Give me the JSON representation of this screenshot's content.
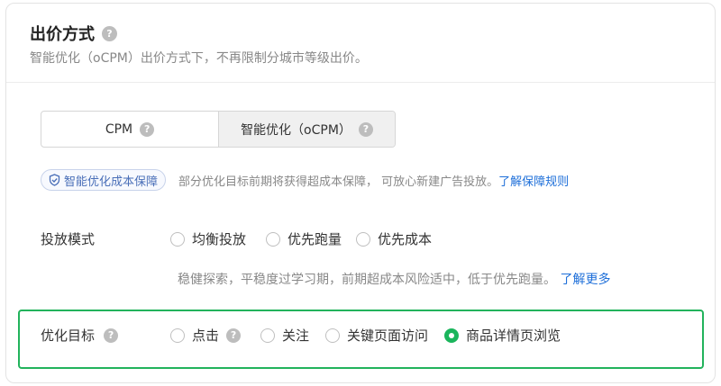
{
  "header": {
    "title": "出价方式",
    "subtitle": "智能优化（oCPM）出价方式下，不再限制分城市等级出价。"
  },
  "bid_type": {
    "options": [
      {
        "label": "CPM",
        "active": false
      },
      {
        "label": "智能优化（oCPM）",
        "active": true
      }
    ]
  },
  "guarantee": {
    "badge": "智能优化成本保障",
    "text": "部分优化目标前期将获得超成本保障， 可放心新建广告投放。",
    "link": "了解保障规则"
  },
  "delivery_mode": {
    "label": "投放模式",
    "options": [
      "均衡投放",
      "优先跑量",
      "优先成本"
    ],
    "description": "稳健探索，平稳度过学习期，前期超成本风险适中，低于优先跑量。",
    "link": "了解更多"
  },
  "optimization_goal": {
    "label": "优化目标",
    "options": [
      "点击",
      "关注",
      "关键页面访问",
      "商品详情页浏览"
    ],
    "selected": "商品详情页浏览"
  },
  "colors": {
    "accent_green": "#1bb55c",
    "link_blue": "#1e6fd9",
    "badge_blue": "#4a6fb8"
  },
  "icons": {
    "help": "question-mark-circle-icon",
    "shield": "shield-check-icon"
  }
}
